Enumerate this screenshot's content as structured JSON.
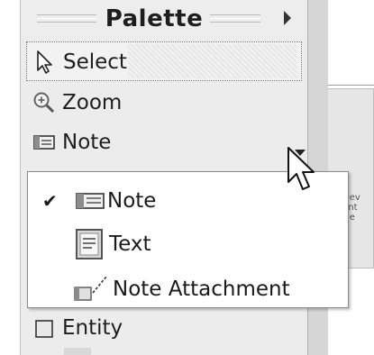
{
  "palette": {
    "title": "Palette",
    "items": [
      {
        "label": "Select",
        "icon": "arrow-cursor-icon",
        "selected": true
      },
      {
        "label": "Zoom",
        "icon": "zoom-icon"
      },
      {
        "label": "Note",
        "icon": "note-icon",
        "has_dropdown": true
      }
    ],
    "entity_label": "Entity"
  },
  "dropdown": {
    "items": [
      {
        "label": "Note",
        "icon": "note-icon",
        "checked": true,
        "check_mark": "✔"
      },
      {
        "label": "Text",
        "icon": "text-icon",
        "checked": false
      },
      {
        "label": "Note Attachment",
        "icon": "note-attachment-icon",
        "checked": false
      }
    ]
  },
  "colors": {
    "panel_bg": "#ececec",
    "menu_bg": "#ffffff",
    "menu_border": "#8a8a8a",
    "text": "#1a1a1a"
  }
}
